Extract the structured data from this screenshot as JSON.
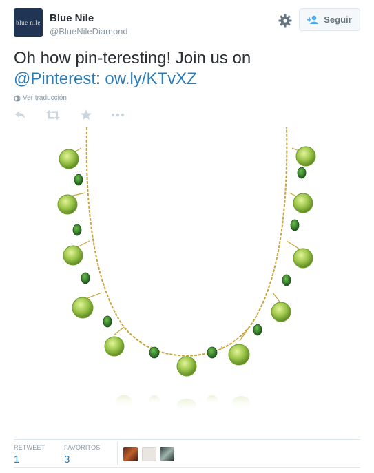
{
  "user": {
    "name": "Blue Nile",
    "handle": "@BlueNileDiamond",
    "avatar_text": "blue nile"
  },
  "header": {
    "follow_label": "Seguir",
    "gear_icon": "gear-icon",
    "follow_icon": "add-user-icon"
  },
  "tweet": {
    "text_part1": "Oh how pin-teresting! Join us on",
    "mention": "@Pinterest",
    "separator": ":",
    "link": "ow.ly/KTvXZ",
    "translate_label": "Ver traducción",
    "translate_icon": "globe-icon"
  },
  "actions": [
    "reply-icon",
    "retweet-icon",
    "favorite-icon",
    "more-icon"
  ],
  "stats": {
    "retweets_label": "RETWEET",
    "retweets_value": "1",
    "favorites_label": "FAVORITOS",
    "favorites_value": "3"
  },
  "colors": {
    "link": "#2b7bb9",
    "muted": "#8899a6",
    "peridot": "#9cc64a",
    "emerald": "#2f7a2c",
    "gold_chain": "#c9a338"
  }
}
